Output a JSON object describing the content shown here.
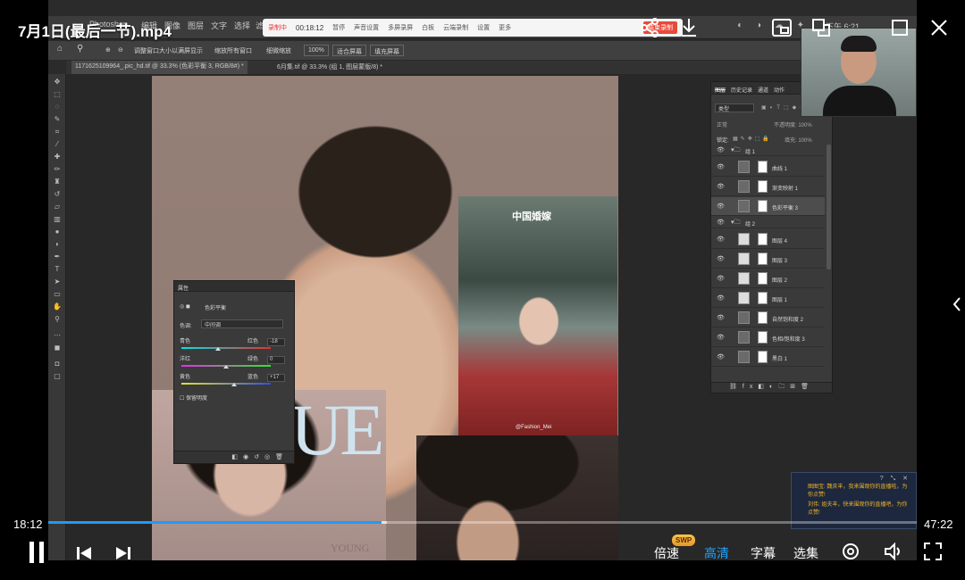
{
  "player": {
    "title": "7月1日(最后一节).mp4",
    "current_time": "18:12",
    "duration": "47:22",
    "progress_fraction": 0.384,
    "buffered_fraction": 0.39,
    "controls": {
      "speed": "倍速",
      "swp_badge": "SWP",
      "quality": "高清",
      "subtitles": "字幕",
      "episodes": "选集"
    }
  },
  "ps": {
    "menus": [
      "Photoshop",
      "编辑",
      "图像",
      "图层",
      "文字",
      "选择",
      "滤镜"
    ],
    "clock": "下午 6:21",
    "recorder": {
      "status": "录制中",
      "time": "00:18:12",
      "items": [
        "暂停",
        "声音设置",
        "多屏录屏",
        "白板",
        "云端录制",
        "设置",
        "更多"
      ],
      "button": "结束录制"
    },
    "options": {
      "resize": "调整窗口大小以满屏显示",
      "zoom_all": "缩放所有窗口",
      "scrubby": "细微缩放",
      "zoom": "100%",
      "fit": "适合屏幕",
      "fill": "填充屏幕"
    },
    "tabs": [
      "1171625109964_.pic_hd.tif @ 33.3% (色彩平衡 3, RGB/8#) *",
      "6月集.tif @ 33.3% (组 1, 图层蒙版/8) *"
    ],
    "properties": {
      "title": "属性",
      "adjustment": "色彩平衡",
      "tone_label": "色调:",
      "tone_value": "中间调",
      "sliders": [
        {
          "left": "青色",
          "right": "红色",
          "value": "-18",
          "fraction": 0.41
        },
        {
          "left": "洋红",
          "right": "绿色",
          "value": "0",
          "fraction": 0.5
        },
        {
          "left": "黄色",
          "right": "蓝色",
          "value": "+17",
          "fraction": 0.59
        }
      ],
      "preserve": "保留明度"
    },
    "layers_panel": {
      "tabs": [
        "图层",
        "历史记录",
        "通道",
        "动作"
      ],
      "filter": "类型",
      "mode": "正常",
      "opacity": "不透明度: 100%",
      "lock": "锁定:",
      "fill": "填充: 100%",
      "rows": [
        {
          "name": "组 1",
          "type": "group"
        },
        {
          "name": "曲线 1",
          "type": "adjust"
        },
        {
          "name": "渐变映射 1",
          "type": "adjust"
        },
        {
          "name": "色彩平衡 3",
          "type": "adjust",
          "selected": true
        },
        {
          "name": "组 2",
          "type": "group"
        },
        {
          "name": "图层 4",
          "type": "pixel"
        },
        {
          "name": "图层 3",
          "type": "pixel"
        },
        {
          "name": "图层 2",
          "type": "pixel"
        },
        {
          "name": "图层 1",
          "type": "pixel"
        },
        {
          "name": "自然饱和度 2",
          "type": "adjust"
        },
        {
          "name": "色相/饱和度 3",
          "type": "adjust"
        },
        {
          "name": "黑白 1",
          "type": "adjust"
        }
      ]
    },
    "photo_text": {
      "brand": "中国婚嫁",
      "watermark": "@Fashion_Mei",
      "mag_title": "UE",
      "mag_sub": "YOUNG"
    },
    "chat": {
      "messages": [
        "图图宝: 魏庆丰，我来围观你的直播啦，为你点赞!",
        "刘伟: 姐夫丰，快来围观你的直播吧，为你点赞!"
      ]
    }
  },
  "icons": [
    "share-icon",
    "download-icon",
    "mini-window-icon",
    "pip-icon",
    "maximize-icon",
    "close-icon",
    "chevron-left-icon",
    "pause-icon",
    "previous-icon",
    "next-icon",
    "danmaku-icon",
    "volume-icon",
    "fullscreen-icon"
  ],
  "colors": {
    "accent": "#1e9bff",
    "chat_text": "#f0b428",
    "recorder_button": "#e84a3a"
  }
}
